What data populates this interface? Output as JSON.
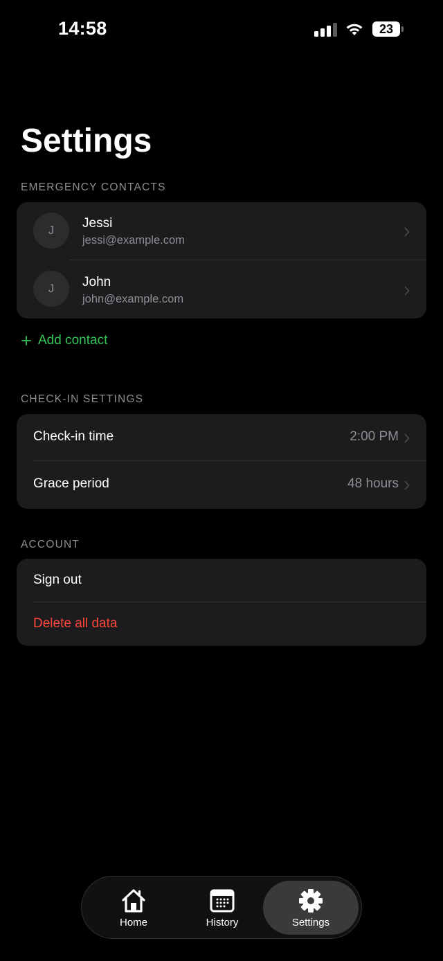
{
  "status_bar": {
    "time": "14:58",
    "battery": "23"
  },
  "page": {
    "title": "Settings"
  },
  "emergency_contacts": {
    "header": "EMERGENCY CONTACTS",
    "contacts": [
      {
        "initial": "J",
        "name": "Jessi",
        "email": "jessi@example.com"
      },
      {
        "initial": "J",
        "name": "John",
        "email": "john@example.com"
      }
    ],
    "add_label": "Add contact"
  },
  "checkin_settings": {
    "header": "CHECK-IN SETTINGS",
    "rows": [
      {
        "label": "Check-in time",
        "value": "2:00 PM"
      },
      {
        "label": "Grace period",
        "value": "48 hours"
      }
    ]
  },
  "account": {
    "header": "ACCOUNT",
    "sign_out": "Sign out",
    "delete": "Delete all data"
  },
  "tabbar": {
    "tabs": [
      {
        "label": "Home",
        "icon": "home-icon"
      },
      {
        "label": "History",
        "icon": "calendar-icon"
      },
      {
        "label": "Settings",
        "icon": "gear-icon",
        "active": true
      }
    ]
  },
  "colors": {
    "background": "#000000",
    "card": "#1c1c1e",
    "accent_green": "#34c759",
    "danger_red": "#ff453a",
    "secondary_text": "#8e8e93"
  }
}
